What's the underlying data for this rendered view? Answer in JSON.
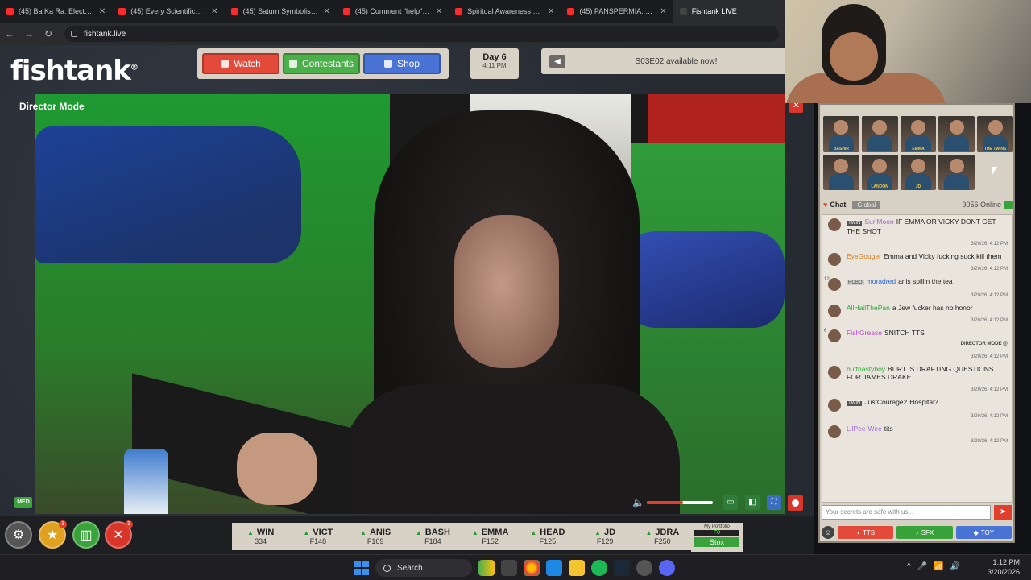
{
  "browser": {
    "tabs": [
      {
        "title": "(45) Ba Ka Ra: Electromagne"
      },
      {
        "title": "(45) Every Scientifically Prove"
      },
      {
        "title": "(45) Saturn Symbolism Deep"
      },
      {
        "title": "(45) Comment \"help\" if you"
      },
      {
        "title": "Spiritual Awareness Will Ru"
      },
      {
        "title": "(45) PANSPERMIA: The Radi"
      },
      {
        "title": "Fishtank LIVE"
      }
    ],
    "url": "fishtank.live"
  },
  "site": {
    "logo": "fishtank",
    "nav": {
      "watch": "Watch",
      "contestants": "Contestants",
      "shop": "Shop"
    },
    "day": {
      "label": "Day 6",
      "time": "4:11 PM"
    },
    "announcement": "S03E02 available now!",
    "player": {
      "mode_label": "Director Mode",
      "quality": "MED",
      "volume_fraction": 0.55
    }
  },
  "ticker": [
    {
      "name": "WIN",
      "value": "334"
    },
    {
      "name": "VICT",
      "value": "F148"
    },
    {
      "name": "ANIS",
      "value": "F169"
    },
    {
      "name": "BASH",
      "value": "F184"
    },
    {
      "name": "EMMA",
      "value": "F152"
    },
    {
      "name": "HEAD",
      "value": "F125"
    },
    {
      "name": "JD",
      "value": "F129"
    },
    {
      "name": "JDRA",
      "value": "F250"
    }
  ],
  "portfolio": {
    "label": "My Portfolio",
    "value": "F0",
    "button": "Stox"
  },
  "contestants": [
    {
      "name": "BASHIR"
    },
    {
      "name": ""
    },
    {
      "name": "EMMA"
    },
    {
      "name": ""
    },
    {
      "name": "THE TWINS"
    },
    {
      "name": ""
    },
    {
      "name": "LANDON"
    },
    {
      "name": "JD"
    },
    {
      "name": ""
    }
  ],
  "chat": {
    "title": "Chat",
    "scope": "Global",
    "online": "9056 Online",
    "messages": [
      {
        "level": "",
        "tag": "TWIN",
        "user": "SunMoon",
        "user_color": "#a06ad8",
        "text": "IF EMMA OR VICKY DONT GET THE SHOT",
        "time": "3/20/26, 4:12 PM"
      },
      {
        "level": "",
        "tag": "",
        "user": "EyeGouger",
        "user_color": "#d07a1a",
        "text": "Emma and Vicky fucking suck kill them",
        "time": "3/20/26, 4:12 PM"
      },
      {
        "level": "12",
        "tag": "ROBO",
        "user": "moradred",
        "user_color": "#2f6bd0",
        "text": "anis spillin the tea",
        "time": "3/20/26, 4:12 PM"
      },
      {
        "level": "",
        "tag": "",
        "user": "AllHailThePan",
        "user_color": "#2fa83a",
        "text": "a Jew fucker has no honor",
        "time": "3/20/26, 4:12 PM"
      },
      {
        "level": "6",
        "tag": "",
        "user": "FishGrease",
        "user_color": "#c04ad0",
        "text": "SNITCH TTS",
        "time": "3/20/26, 4:12 PM",
        "note": "DIRECTOR MODE @"
      },
      {
        "level": "",
        "tag": "",
        "user": "buffnastyboy",
        "user_color": "#2fa83a",
        "text": "BURT IS DRAFTING QUESTIONS FOR JAMES DRAKE",
        "time": "3/20/26, 4:12 PM"
      },
      {
        "level": "",
        "tag": "TWIN",
        "user": "JustCourage2",
        "user_color": "#222222",
        "text": "Hospital?",
        "time": "3/20/26, 4:12 PM"
      },
      {
        "level": "",
        "tag": "",
        "user": "LilPee-Wee",
        "user_color": "#a06ad8",
        "text": "tits",
        "time": "3/20/26, 4:12 PM"
      }
    ],
    "input_placeholder": "Your secrets are safe with us...",
    "buttons": {
      "tts": "TTS",
      "sfx": "SFX",
      "toy": "TOY"
    }
  },
  "taskbar": {
    "search": "Search",
    "time": "1:12 PM",
    "date": "3/20/2026"
  },
  "colors": {
    "accent_red": "#e34a3a",
    "accent_green": "#4cb04a",
    "accent_blue": "#4a73d6",
    "panel": "#d8d2c6"
  }
}
